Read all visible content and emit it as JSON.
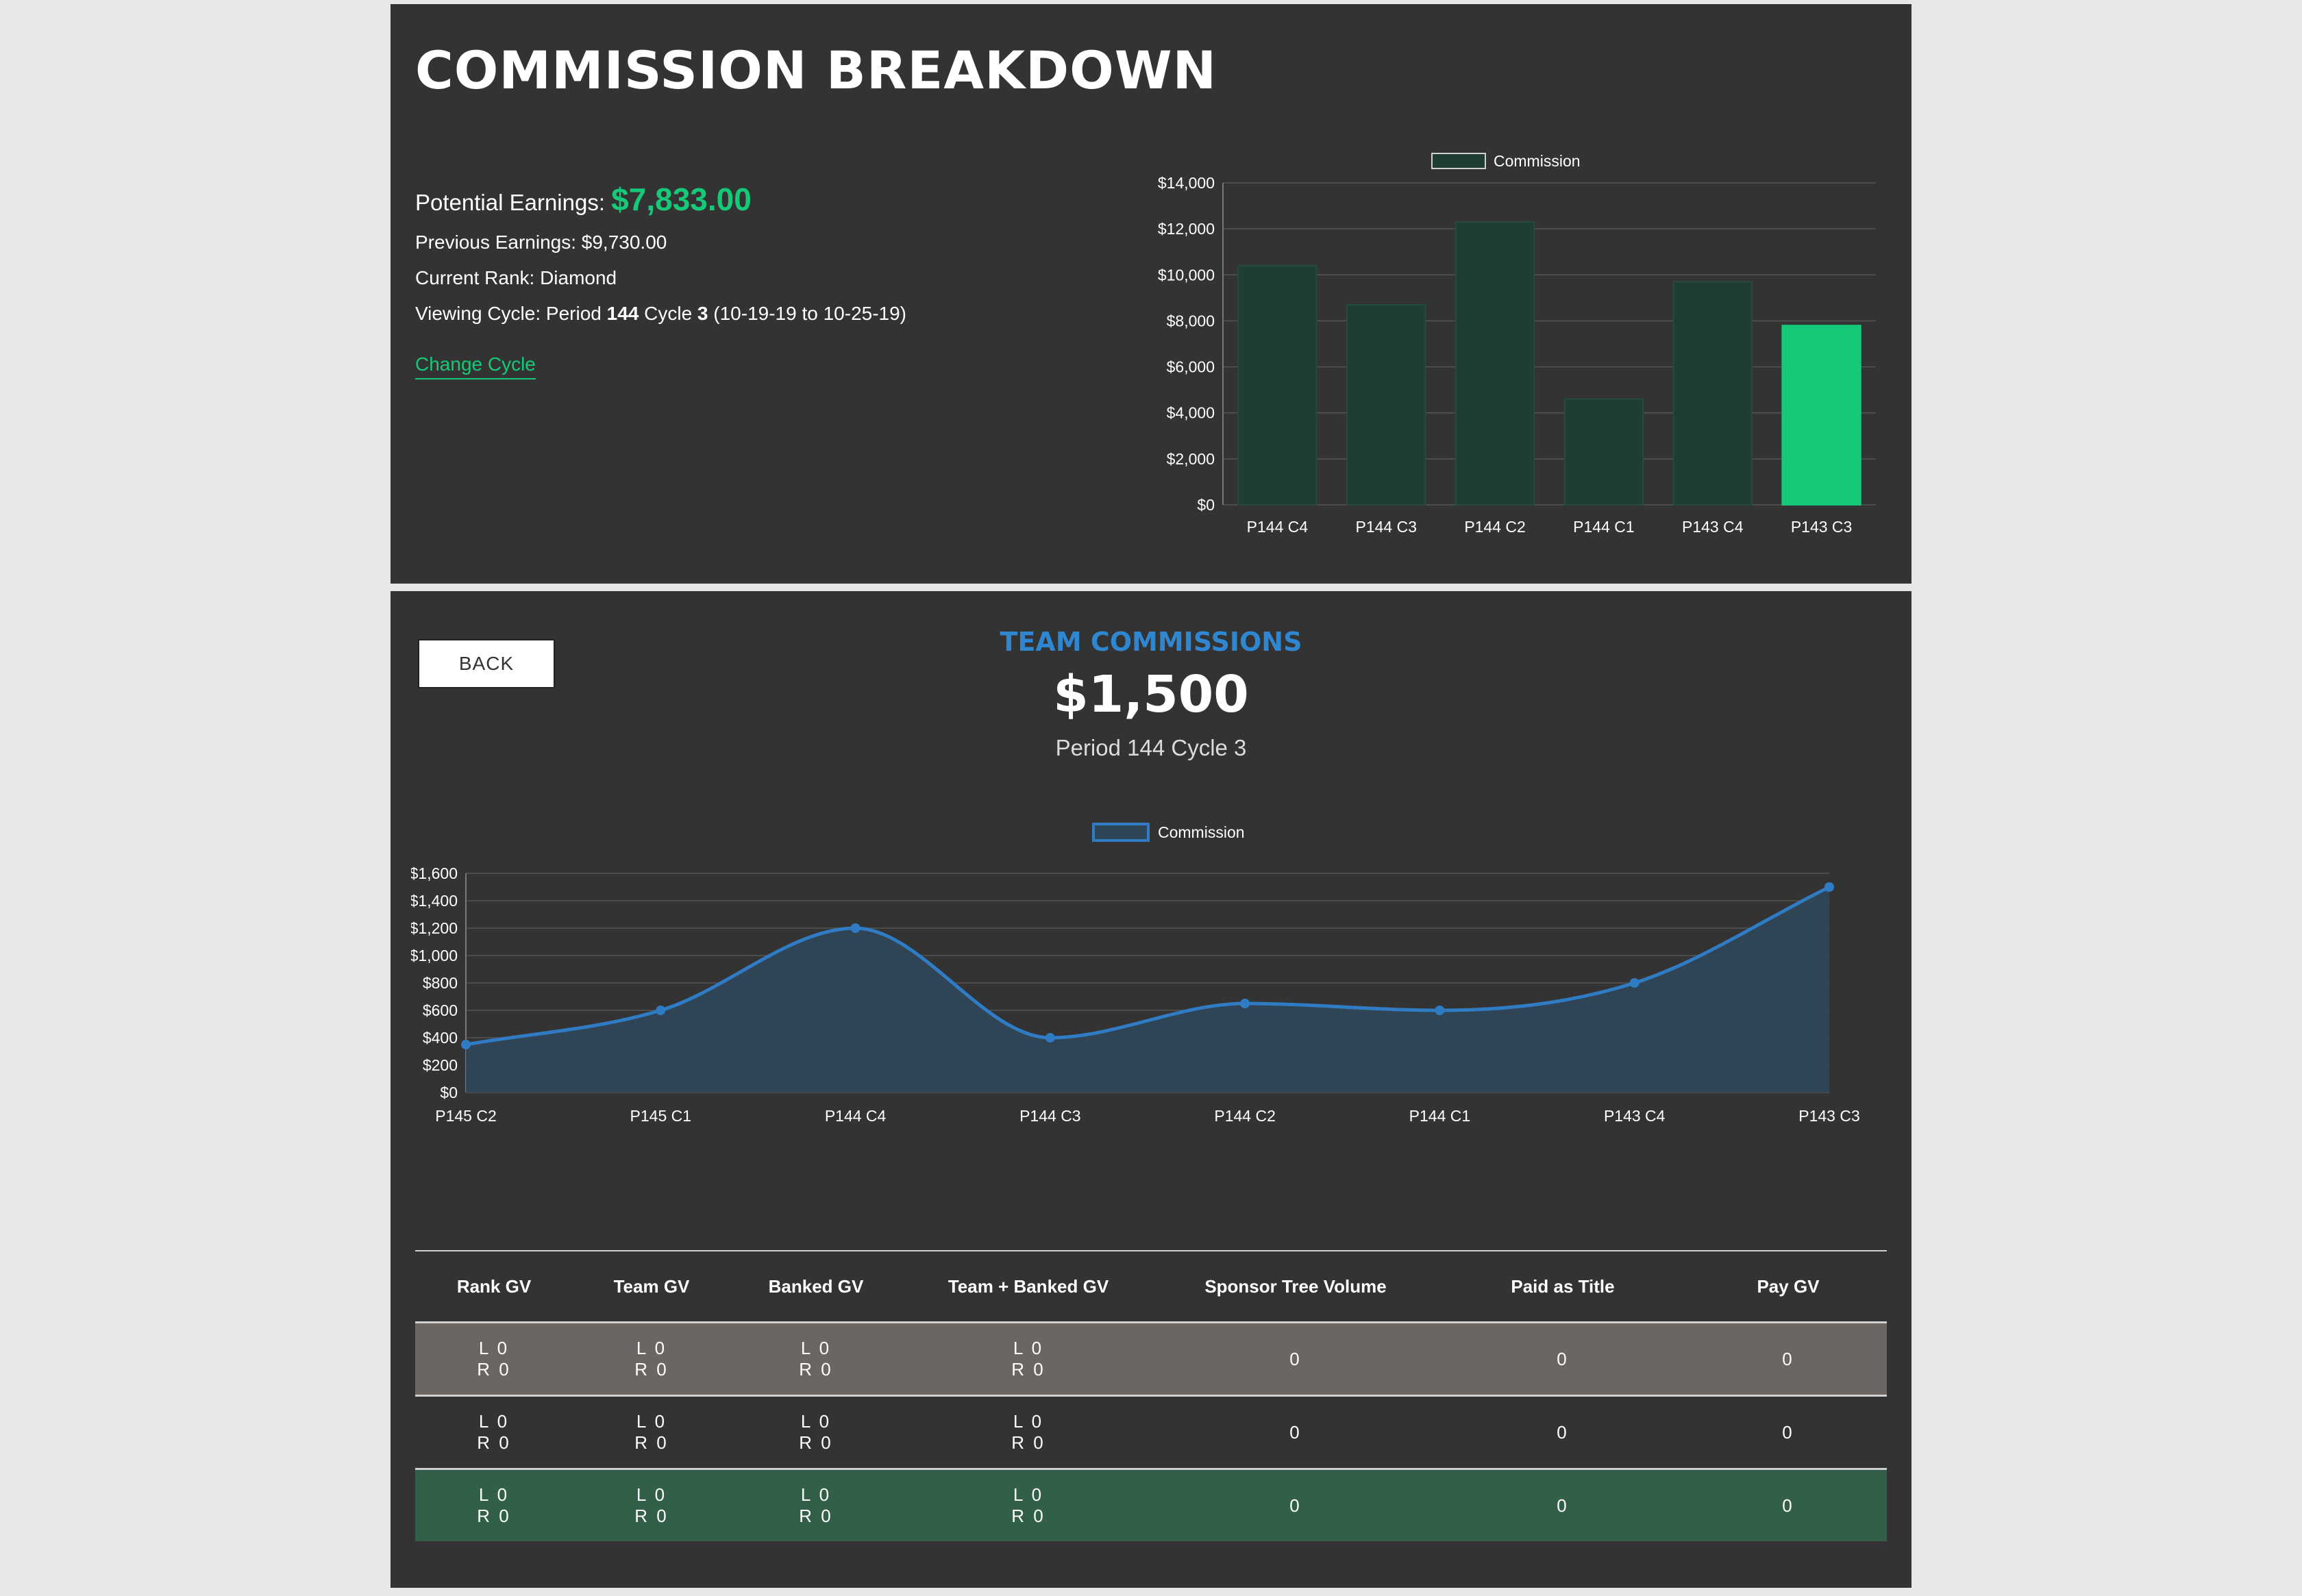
{
  "header": {
    "title": "COMMISSION BREAKDOWN",
    "potential_label": "Potential Earnings: ",
    "potential_value": "$7,833.00",
    "previous_earnings": "Previous Earnings: $9,730.00",
    "current_rank": "Current Rank: Diamond",
    "cycle_prefix": "Viewing Cycle: Period ",
    "cycle_period": "144",
    "cycle_mid": " Cycle ",
    "cycle_number": "3",
    "cycle_dates": " (10-19-19 to 10-25-19)",
    "change_cycle": "Change Cycle"
  },
  "team": {
    "back_label": "BACK",
    "title": "TEAM COMMISSIONS",
    "amount": "$1,500",
    "period": "Period 144 Cycle 3"
  },
  "colors": {
    "accent_green": "#16c978",
    "bar_dark": "#1f3d33",
    "line_blue": "#2f7bc4",
    "area_fill": "#2f4659",
    "title_blue": "#2f86d1"
  },
  "chart_data": [
    {
      "type": "bar",
      "legend": "Commission",
      "legend_position": "top",
      "categories": [
        "P144 C4",
        "P144 C3",
        "P144 C2",
        "P144 C1",
        "P143 C4",
        "P143 C3"
      ],
      "values": [
        10400,
        8700,
        12300,
        4600,
        9700,
        7800
      ],
      "highlight_index": 5,
      "ylim": [
        0,
        14000
      ],
      "yticks": [
        "$0",
        "$2,000",
        "$4,000",
        "$6,000",
        "$8,000",
        "$10,000",
        "$12,000",
        "$14,000"
      ],
      "grid": true
    },
    {
      "type": "area",
      "legend": "Commission",
      "legend_position": "top",
      "categories": [
        "P145 C2",
        "P145 C1",
        "P144 C4",
        "P144 C3",
        "P144 C2",
        "P144 C1",
        "P143 C4",
        "P143 C3"
      ],
      "values": [
        350,
        600,
        1200,
        400,
        650,
        600,
        800,
        1500
      ],
      "ylim": [
        0,
        1600
      ],
      "yticks": [
        "$0",
        "$200",
        "$400",
        "$600",
        "$800",
        "$1,000",
        "$1,200",
        "$1,400",
        "$1,600"
      ],
      "grid": true
    }
  ],
  "table": {
    "headers": [
      "Rank GV",
      "Team GV",
      "Banked GV",
      "Team + Banked GV",
      "Sponsor Tree Volume",
      "Paid as Title",
      "Pay GV"
    ],
    "rows": [
      {
        "rank_l": "L 0",
        "rank_r": "R 0",
        "team_l": "L 0",
        "team_r": "R 0",
        "banked_l": "L 0",
        "banked_r": "R 0",
        "tb_l": "L 0",
        "tb_r": "R 0",
        "sponsor": "0",
        "paid_title": "0",
        "pay_gv": "0"
      },
      {
        "rank_l": "L 0",
        "rank_r": "R 0",
        "team_l": "L 0",
        "team_r": "R 0",
        "banked_l": "L 0",
        "banked_r": "R 0",
        "tb_l": "L 0",
        "tb_r": "R 0",
        "sponsor": "0",
        "paid_title": "0",
        "pay_gv": "0"
      },
      {
        "rank_l": "L 0",
        "rank_r": "R 0",
        "team_l": "L 0",
        "team_r": "R 0",
        "banked_l": "L 0",
        "banked_r": "R 0",
        "tb_l": "L 0",
        "tb_r": "R 0",
        "sponsor": "0",
        "paid_title": "0",
        "pay_gv": "0"
      }
    ]
  }
}
